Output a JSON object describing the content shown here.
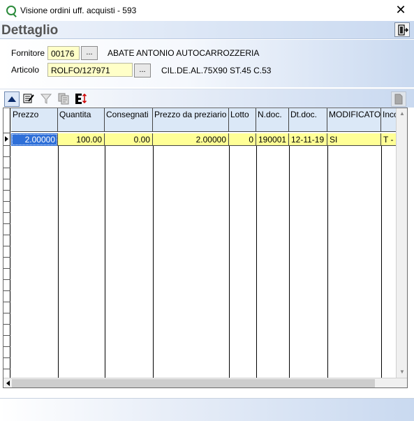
{
  "window": {
    "title": "Visione ordini uff. acquisti - 593",
    "close_glyph": "✕"
  },
  "header": {
    "title": "Dettaglio",
    "exit_icon": "exit-door-icon"
  },
  "form": {
    "fornitore_label": "Fornitore",
    "fornitore_value": "00176",
    "fornitore_lookup": "...",
    "fornitore_name": "ABATE ANTONIO AUTOCARROZZERIA",
    "articolo_label": "Articolo",
    "articolo_value": "ROLFO/127971",
    "articolo_lookup": "...",
    "articolo_description": "CIL.DE.AL.75X90 ST.45 C.53"
  },
  "toolbar": {
    "icons": [
      "triangle-up-icon",
      "edit-list-icon",
      "filter-icon",
      "copy-icon",
      "export-excel-icon"
    ],
    "right_icon": "document-icon"
  },
  "grid": {
    "columns": [
      "Prezzo",
      "Quantita",
      "Consegnati",
      "Prezzo da preziario",
      "Lotto",
      "N.doc.",
      "Dt.doc.",
      "MODIFICATO",
      "Inco"
    ],
    "rows": [
      {
        "prezzo": "2.00000",
        "quantita": "100.00",
        "consegnati": "0.00",
        "prezzo_preziario": "2.00000",
        "lotto": "0",
        "n_doc": "190001",
        "dt_doc": "12-11-19",
        "modificato": "SI",
        "inco": "T - I"
      }
    ]
  },
  "colors": {
    "header_bg": "#dbe8f7",
    "row_bg": "#ffff96",
    "selected_bg": "#2e6fd8",
    "input_bg": "#ffffc8"
  }
}
